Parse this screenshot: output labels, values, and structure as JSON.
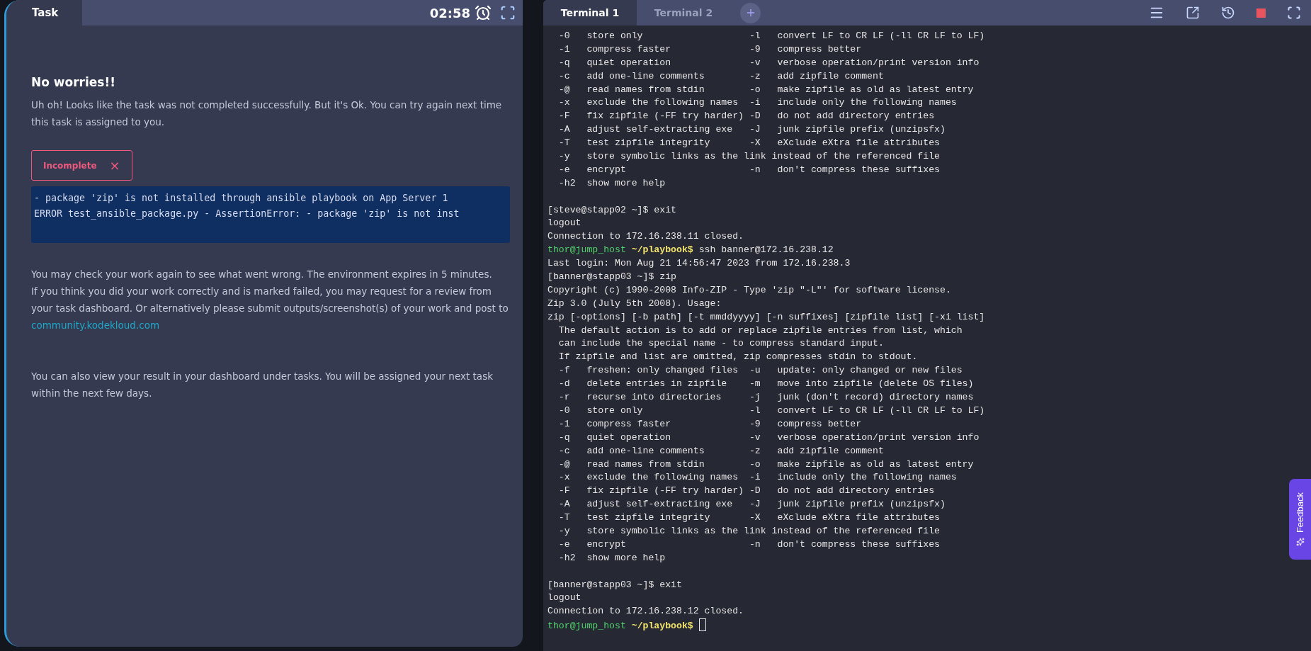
{
  "task_panel": {
    "tab": {
      "label": "Task",
      "selected": true
    },
    "timer": "02:58",
    "heading": "No worries!!",
    "message": "Uh oh! Looks like the task was not completed successfully. But it's Ok. You can try again next time this task is assigned to you.",
    "status_badge": {
      "label": "Incomplete",
      "icon": "×"
    },
    "error_log": [
      "- package 'zip' is not installed through ansible playbook on App Server 1",
      "ERROR test_ansible_package.py - AssertionError: - package 'zip' is not inst"
    ],
    "info_lines": [
      "You may check your work again to see what went wrong. The environment expires in 5 minutes.",
      "If you think you did your work correctly and is marked failed, you may request for a review from your task dashboard. Or alternatively please submit outputs/screenshot(s) of your work and post to"
    ],
    "link": "community.kodekloud.com",
    "footer_note": "You can also view your result in your dashboard under tasks. You will be assigned your next task within the next few days."
  },
  "terminal": {
    "tabs": [
      {
        "label": "Terminal 1",
        "selected": true
      },
      {
        "label": "Terminal 2",
        "selected": false
      }
    ],
    "lines": [
      {
        "kind": "output",
        "text": "  -0   store only                   -l   convert LF to CR LF (-ll CR LF to LF)"
      },
      {
        "kind": "output",
        "text": "  -1   compress faster              -9   compress better"
      },
      {
        "kind": "output",
        "text": "  -q   quiet operation              -v   verbose operation/print version info"
      },
      {
        "kind": "output",
        "text": "  -c   add one-line comments        -z   add zipfile comment"
      },
      {
        "kind": "output",
        "text": "  -@   read names from stdin        -o   make zipfile as old as latest entry"
      },
      {
        "kind": "output",
        "text": "  -x   exclude the following names  -i   include only the following names"
      },
      {
        "kind": "output",
        "text": "  -F   fix zipfile (-FF try harder) -D   do not add directory entries"
      },
      {
        "kind": "output",
        "text": "  -A   adjust self-extracting exe   -J   junk zipfile prefix (unzipsfx)"
      },
      {
        "kind": "output",
        "text": "  -T   test zipfile integrity       -X   eXclude eXtra file attributes"
      },
      {
        "kind": "output",
        "text": "  -y   store symbolic links as the link instead of the referenced file"
      },
      {
        "kind": "output",
        "text": "  -e   encrypt                      -n   don't compress these suffixes"
      },
      {
        "kind": "output",
        "text": "  -h2  show more help"
      },
      {
        "kind": "blank"
      },
      {
        "kind": "output",
        "text": "[steve@stapp02 ~]$ exit"
      },
      {
        "kind": "output",
        "text": "logout"
      },
      {
        "kind": "output",
        "text": "Connection to 172.16.238.11 closed."
      },
      {
        "kind": "prompt",
        "user": "thor@jump_host",
        "path": "~/playbook$",
        "command": "ssh banner@172.16.238.12"
      },
      {
        "kind": "output",
        "text": "Last login: Mon Aug 21 14:56:47 2023 from 172.16.238.3"
      },
      {
        "kind": "output",
        "text": "[banner@stapp03 ~]$ zip"
      },
      {
        "kind": "output",
        "text": "Copyright (c) 1990-2008 Info-ZIP - Type 'zip \"-L\"' for software license."
      },
      {
        "kind": "output",
        "text": "Zip 3.0 (July 5th 2008). Usage:"
      },
      {
        "kind": "output",
        "text": "zip [-options] [-b path] [-t mmddyyyy] [-n suffixes] [zipfile list] [-xi list]"
      },
      {
        "kind": "output",
        "text": "  The default action is to add or replace zipfile entries from list, which"
      },
      {
        "kind": "output",
        "text": "  can include the special name - to compress standard input."
      },
      {
        "kind": "output",
        "text": "  If zipfile and list are omitted, zip compresses stdin to stdout."
      },
      {
        "kind": "output",
        "text": "  -f   freshen: only changed files  -u   update: only changed or new files"
      },
      {
        "kind": "output",
        "text": "  -d   delete entries in zipfile    -m   move into zipfile (delete OS files)"
      },
      {
        "kind": "output",
        "text": "  -r   recurse into directories     -j   junk (don't record) directory names"
      },
      {
        "kind": "output",
        "text": "  -0   store only                   -l   convert LF to CR LF (-ll CR LF to LF)"
      },
      {
        "kind": "output",
        "text": "  -1   compress faster              -9   compress better"
      },
      {
        "kind": "output",
        "text": "  -q   quiet operation              -v   verbose operation/print version info"
      },
      {
        "kind": "output",
        "text": "  -c   add one-line comments        -z   add zipfile comment"
      },
      {
        "kind": "output",
        "text": "  -@   read names from stdin        -o   make zipfile as old as latest entry"
      },
      {
        "kind": "output",
        "text": "  -x   exclude the following names  -i   include only the following names"
      },
      {
        "kind": "output",
        "text": "  -F   fix zipfile (-FF try harder) -D   do not add directory entries"
      },
      {
        "kind": "output",
        "text": "  -A   adjust self-extracting exe   -J   junk zipfile prefix (unzipsfx)"
      },
      {
        "kind": "output",
        "text": "  -T   test zipfile integrity       -X   eXclude eXtra file attributes"
      },
      {
        "kind": "output",
        "text": "  -y   store symbolic links as the link instead of the referenced file"
      },
      {
        "kind": "output",
        "text": "  -e   encrypt                      -n   don't compress these suffixes"
      },
      {
        "kind": "output",
        "text": "  -h2  show more help"
      },
      {
        "kind": "blank"
      },
      {
        "kind": "output",
        "text": "[banner@stapp03 ~]$ exit"
      },
      {
        "kind": "output",
        "text": "logout"
      },
      {
        "kind": "output",
        "text": "Connection to 172.16.238.12 closed."
      },
      {
        "kind": "prompt",
        "user": "thor@jump_host",
        "path": "~/playbook$",
        "cursor": true
      }
    ]
  },
  "feedback_tab": {
    "label": "Feedback"
  }
}
